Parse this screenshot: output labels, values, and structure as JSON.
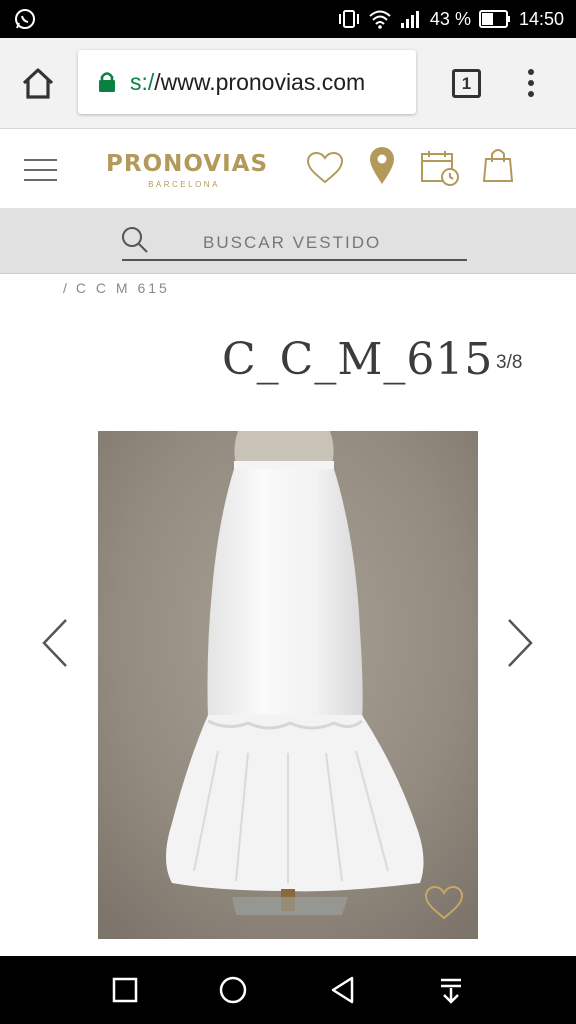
{
  "status_bar": {
    "battery_percent": "43 %",
    "time": "14:50",
    "icons": [
      "whatsapp-icon",
      "vibrate-icon",
      "wifi-icon",
      "signal-icon",
      "battery-icon"
    ]
  },
  "browser": {
    "url_scheme": "s:/",
    "url_rest": "/www.pronovias.com",
    "tab_count": "1"
  },
  "site": {
    "logo_main": "PRONOVIAS",
    "logo_sub": "BARCELONA",
    "brand_color": "#b39a5a"
  },
  "search": {
    "placeholder": "BUSCAR VESTIDO"
  },
  "breadcrumb": {
    "separator": "/",
    "current": "C C M 615"
  },
  "product": {
    "title": "C_C_M_615",
    "counter": "3/8"
  }
}
